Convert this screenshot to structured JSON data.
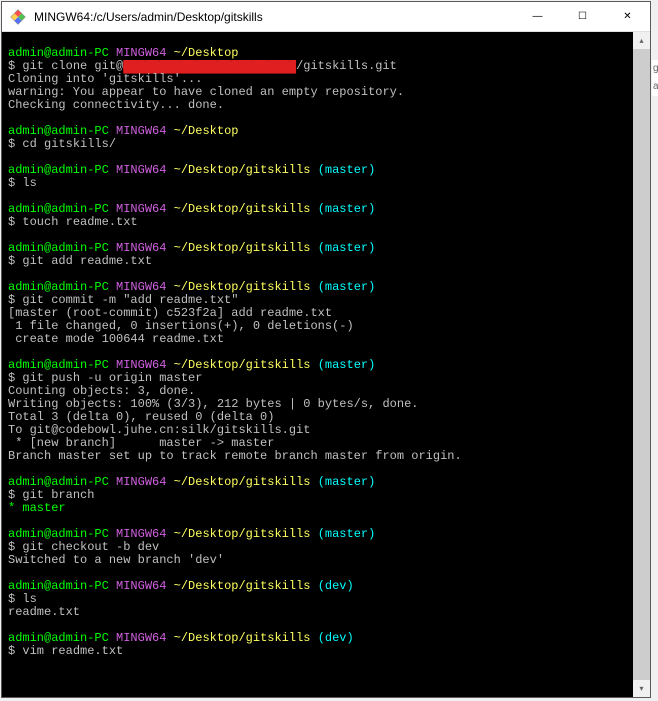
{
  "window": {
    "title": "MINGW64:/c/Users/admin/Desktop/gitskills",
    "minimize": "—",
    "maximize": "☐",
    "close": "✕"
  },
  "prompt": {
    "user_host": "admin@admin-PC",
    "env": "MINGW64",
    "path_desktop": "~/Desktop",
    "path_repo": "~/Desktop/gitskills",
    "branch_master": "(master)",
    "branch_dev": "(dev)",
    "dollar": "$ "
  },
  "redaction": "████████████████████████",
  "cmds": {
    "clone_pre": "git clone git@",
    "clone_post": "/gitskills.git",
    "cd": "cd gitskills/",
    "ls": "ls",
    "touch": "touch readme.txt",
    "add": "git add readme.txt",
    "commit": "git commit -m \"add readme.txt\"",
    "push": "git push -u origin master",
    "branch": "git branch",
    "checkout": "git checkout -b dev",
    "vim": "vim readme.txt"
  },
  "out": {
    "cloning": "Cloning into 'gitskills'...",
    "warn_empty": "warning: You appear to have cloned an empty repository.",
    "check_conn": "Checking connectivity... done.",
    "commit1": "[master (root-commit) c523f2a] add readme.txt",
    "commit2": " 1 file changed, 0 insertions(+), 0 deletions(-)",
    "commit3": " create mode 100644 readme.txt",
    "push1": "Counting objects: 3, done.",
    "push2": "Writing objects: 100% (3/3), 212 bytes | 0 bytes/s, done.",
    "push3": "Total 3 (delta 0), reused 0 (delta 0)",
    "push4": "To git@codebowl.juhe.cn:silk/gitskills.git",
    "push5": " * [new branch]      master -> master",
    "push6": "Branch master set up to track remote branch master from origin.",
    "branch_out": "* ",
    "branch_name": "master",
    "checkout_out": "Switched to a new branch 'dev'",
    "ls_out": "readme.txt"
  },
  "scroll": {
    "up": "▴",
    "down": "▾"
  },
  "side": {
    "a": "g",
    "b": "a"
  }
}
